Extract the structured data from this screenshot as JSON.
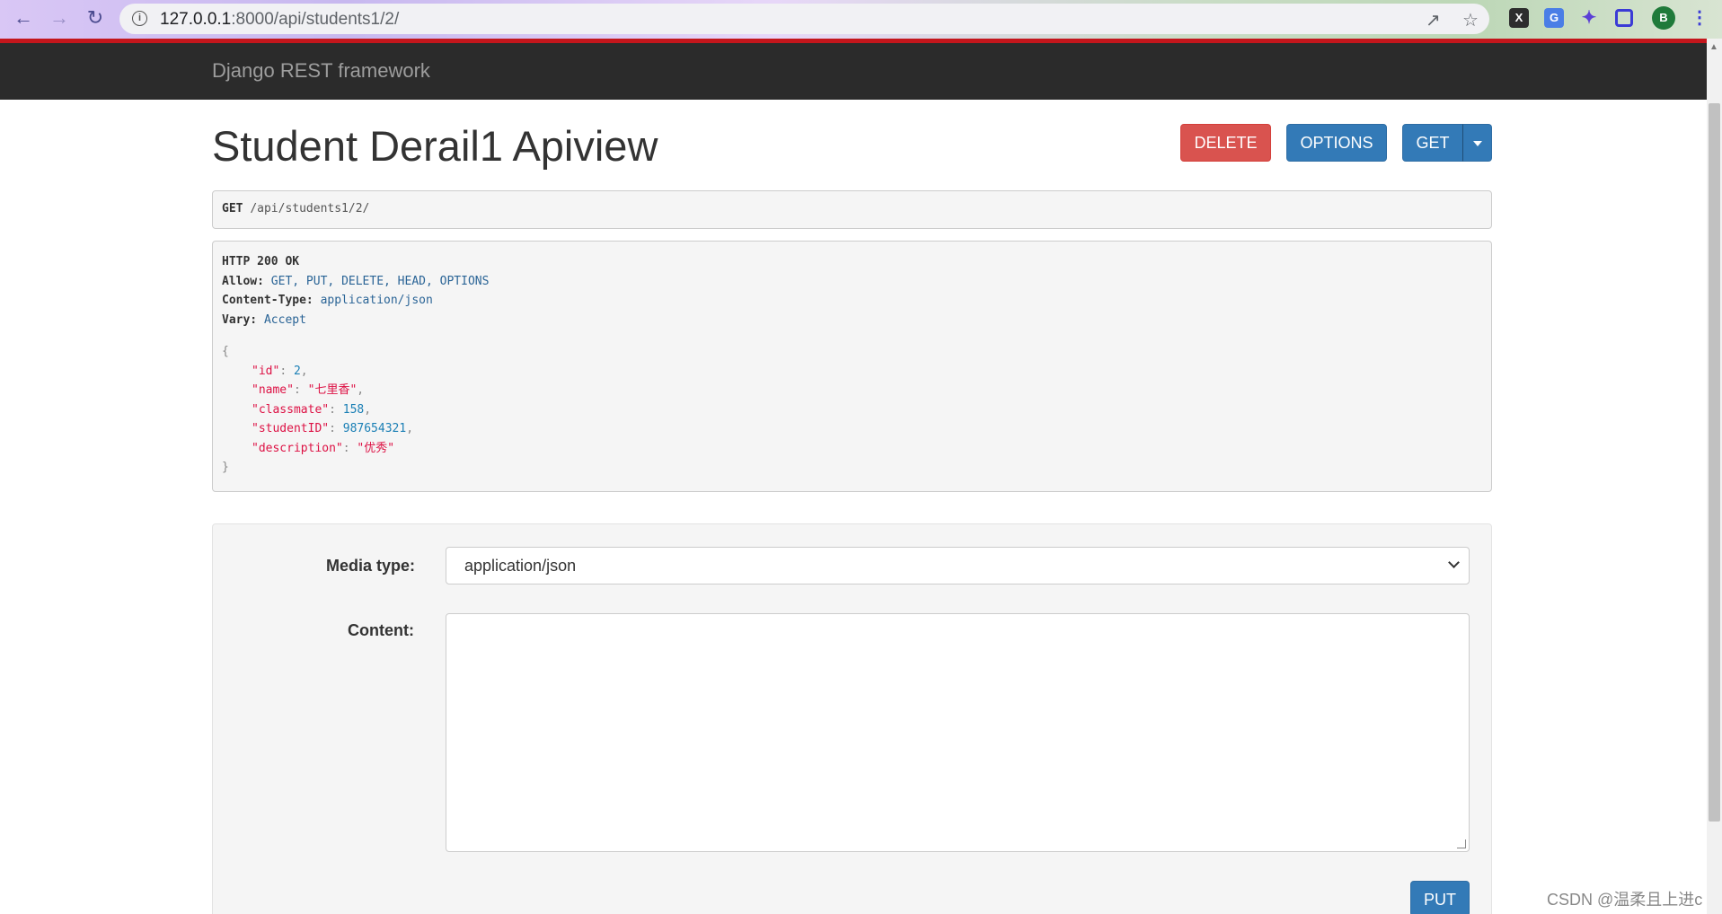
{
  "browser": {
    "url_host": "127.0.0.1",
    "url_rest": ":8000/api/students1/2/",
    "profile_initial": "B"
  },
  "navbar": {
    "brand": "Django REST framework"
  },
  "page": {
    "title": "Student Derail1 Apiview"
  },
  "actions": {
    "delete_label": "DELETE",
    "options_label": "OPTIONS",
    "get_label": "GET"
  },
  "request": {
    "method": "GET",
    "path": "/api/students1/2/"
  },
  "response": {
    "status": "HTTP 200 OK",
    "headers": [
      {
        "name": "Allow:",
        "value": "GET, PUT, DELETE, HEAD, OPTIONS"
      },
      {
        "name": "Content-Type:",
        "value": "application/json"
      },
      {
        "name": "Vary:",
        "value": "Accept"
      }
    ],
    "open_brace": "{",
    "close_brace": "}",
    "fields": [
      {
        "key": "\"id\"",
        "value": "2",
        "type": "num"
      },
      {
        "key": "\"name\"",
        "value": "\"七里香\"",
        "type": "str"
      },
      {
        "key": "\"classmate\"",
        "value": "158",
        "type": "num"
      },
      {
        "key": "\"studentID\"",
        "value": "987654321",
        "type": "num"
      },
      {
        "key": "\"description\"",
        "value": "\"优秀\"",
        "type": "str"
      }
    ]
  },
  "form": {
    "media_type_label": "Media type:",
    "media_type_value": "application/json",
    "content_label": "Content:",
    "content_value": "",
    "put_label": "PUT"
  },
  "watermark": "CSDN @温柔且上进c",
  "colors": {
    "navbar": "#2b2b2b",
    "accent_red": "#c4161c",
    "primary": "#337ab7",
    "danger": "#d9534f"
  }
}
